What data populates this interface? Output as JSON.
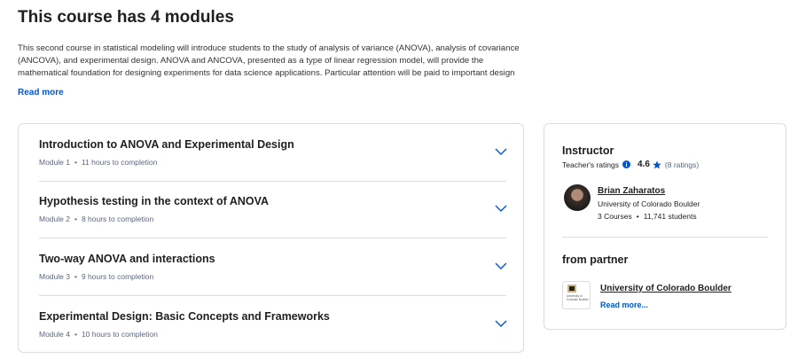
{
  "course": {
    "heading": "This course has 4 modules",
    "description": "This second course in statistical modeling will introduce students to the study of analysis of variance (ANOVA), analysis of covariance (ANCOVA), and experimental design. ANOVA and ANCOVA, presented as a type of linear regression model, will provide the mathematical foundation for designing experiments for data science applications. Particular attention will be paid to important design",
    "read_more": "Read more"
  },
  "modules": [
    {
      "title": "Introduction to ANOVA and Experimental Design",
      "number": "Module 1",
      "duration": "11 hours to completion"
    },
    {
      "title": "Hypothesis testing in the context of ANOVA",
      "number": "Module 2",
      "duration": "8 hours to completion"
    },
    {
      "title": "Two-way ANOVA and interactions",
      "number": "Module 3",
      "duration": "9 hours to completion"
    },
    {
      "title": "Experimental Design: Basic Concepts and Frameworks",
      "number": "Module 4",
      "duration": "10 hours to completion"
    }
  ],
  "instructor": {
    "section_title": "Instructor",
    "ratings_label": "Teacher's ratings",
    "rating": "4.6",
    "rating_count": "(8 ratings)",
    "name": "Brian Zaharatos",
    "organization": "University of Colorado Boulder",
    "courses": "3 Courses",
    "students": "11,741 students"
  },
  "partner": {
    "section_title": "from partner",
    "name": "University of Colorado Boulder",
    "more": "Read more...",
    "logo_text": "University of Colorado Boulder"
  },
  "colors": {
    "link": "#0056d2",
    "text": "#1f1f1f",
    "muted": "#5b6780",
    "border": "#dadce0"
  },
  "icons": {
    "chevron": "chevron-down-icon",
    "info": "info-icon",
    "star": "star-icon"
  }
}
